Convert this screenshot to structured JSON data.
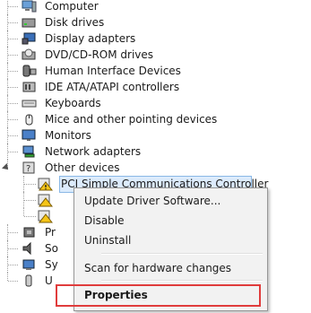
{
  "tree": {
    "categories": [
      {
        "label": "Computer",
        "icon": "computer-icon"
      },
      {
        "label": "Disk drives",
        "icon": "disk-drive-icon"
      },
      {
        "label": "Display adapters",
        "icon": "display-adapter-icon"
      },
      {
        "label": "DVD/CD-ROM drives",
        "icon": "dvd-drive-icon"
      },
      {
        "label": "Human Interface Devices",
        "icon": "hid-icon"
      },
      {
        "label": "IDE ATA/ATAPI controllers",
        "icon": "ide-controller-icon"
      },
      {
        "label": "Keyboards",
        "icon": "keyboard-icon"
      },
      {
        "label": "Mice and other pointing devices",
        "icon": "mouse-icon"
      },
      {
        "label": "Monitors",
        "icon": "monitor-icon"
      },
      {
        "label": "Network adapters",
        "icon": "network-adapter-icon"
      },
      {
        "label": "Other devices",
        "icon": "other-devices-icon"
      }
    ],
    "other_devices_children": [
      {
        "label": "PCI Simple Communications Controller",
        "icon": "warning-device-icon"
      }
    ],
    "partial_rows": [
      {
        "label": "Pr",
        "icon": "processor-icon"
      },
      {
        "label": "So",
        "icon": "sound-icon"
      },
      {
        "label": "Sy",
        "icon": "system-icon"
      },
      {
        "label": "U",
        "icon": "usb-icon"
      }
    ]
  },
  "context_menu": {
    "items": [
      {
        "label": "Update Driver Software..."
      },
      {
        "label": "Disable"
      },
      {
        "label": "Uninstall"
      },
      {
        "label": "Scan for hardware changes"
      },
      {
        "label": "Properties"
      }
    ]
  },
  "colors": {
    "highlight_border": "#e03c3c",
    "selection_fill": "#dcebfc",
    "warning_yellow": "#f5c518"
  }
}
